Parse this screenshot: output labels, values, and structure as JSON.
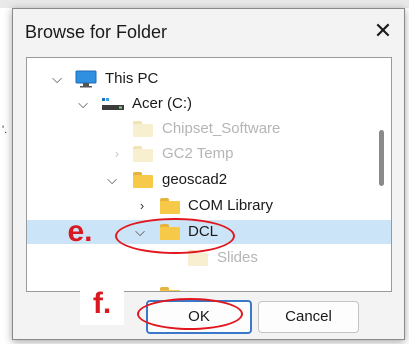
{
  "dialog": {
    "title": "Browse for Folder",
    "close_label": "✕"
  },
  "tree": {
    "items": [
      {
        "label": "This PC"
      },
      {
        "label": "Acer (C:)"
      },
      {
        "label": "Chipset_Software"
      },
      {
        "label": "GC2 Temp"
      },
      {
        "label": "geoscad2"
      },
      {
        "label": "COM Library"
      },
      {
        "label": "DCL"
      },
      {
        "label": "Slides"
      }
    ]
  },
  "buttons": {
    "ok_label": "OK",
    "cancel_label": "Cancel"
  },
  "annotations": {
    "step_e": "e.",
    "step_f": "f."
  },
  "colors": {
    "annotation_red": "#e0181e",
    "selection": "#cce4f7",
    "folder": "#f7c948"
  },
  "stray_char": "'."
}
